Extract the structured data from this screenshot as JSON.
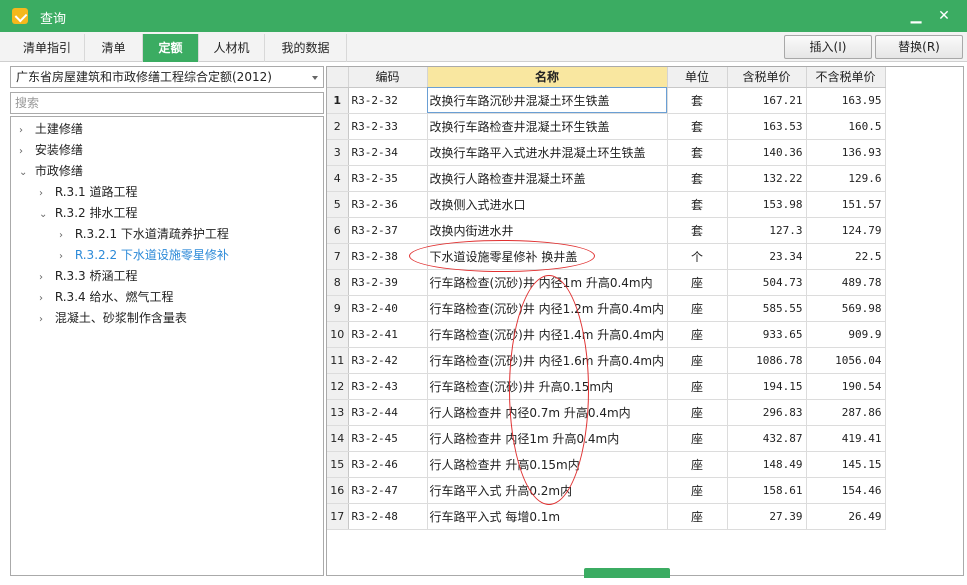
{
  "window": {
    "title": "查询",
    "minimize": "▁",
    "close": "✕"
  },
  "tabs": [
    {
      "label": "清单指引"
    },
    {
      "label": "清单"
    },
    {
      "label": "定额"
    },
    {
      "label": "人材机"
    },
    {
      "label": "我的数据"
    }
  ],
  "actions": {
    "insert": "插入(I)",
    "replace": "替换(R)"
  },
  "library": {
    "selected": "广东省房屋建筑和市政修缮工程综合定额(2012)"
  },
  "search": {
    "placeholder": "搜索"
  },
  "tree": [
    {
      "label": "土建修缮",
      "arrow": "›"
    },
    {
      "label": "安装修缮",
      "arrow": "›"
    },
    {
      "label": "市政修缮",
      "arrow": "⌄"
    },
    {
      "label": "R.3.1 道路工程",
      "arrow": "›"
    },
    {
      "label": "R.3.2 排水工程",
      "arrow": "⌄"
    },
    {
      "label": "R.3.2.1 下水道清疏养护工程",
      "arrow": "›"
    },
    {
      "label": "R.3.2.2 下水道设施零星修补",
      "arrow": "›"
    },
    {
      "label": "R.3.3 桥涵工程",
      "arrow": "›"
    },
    {
      "label": "R.3.4 给水、燃气工程",
      "arrow": "›"
    },
    {
      "label": "混凝土、砂浆制作含量表",
      "arrow": "›"
    }
  ],
  "table": {
    "headers": {
      "code": "编码",
      "name": "名称",
      "unit": "单位",
      "price_tax": "含税单价",
      "price_notax": "不含税单价"
    },
    "rows": [
      {
        "n": "1",
        "code": "R3-2-32",
        "name": "改换行车路沉砂井混凝土环生铁盖",
        "unit": "套",
        "price_tax": "167.21",
        "price_notax": "163.95"
      },
      {
        "n": "2",
        "code": "R3-2-33",
        "name": "改换行车路检查井混凝土环生铁盖",
        "unit": "套",
        "price_tax": "163.53",
        "price_notax": "160.5"
      },
      {
        "n": "3",
        "code": "R3-2-34",
        "name": "改换行车路平入式进水井混凝土环生铁盖",
        "unit": "套",
        "price_tax": "140.36",
        "price_notax": "136.93"
      },
      {
        "n": "4",
        "code": "R3-2-35",
        "name": "改换行人路检查井混凝土环盖",
        "unit": "套",
        "price_tax": "132.22",
        "price_notax": "129.6"
      },
      {
        "n": "5",
        "code": "R3-2-36",
        "name": "改换侧入式进水口",
        "unit": "套",
        "price_tax": "153.98",
        "price_notax": "151.57"
      },
      {
        "n": "6",
        "code": "R3-2-37",
        "name": "改换内街进水井",
        "unit": "套",
        "price_tax": "127.3",
        "price_notax": "124.79"
      },
      {
        "n": "7",
        "code": "R3-2-38",
        "name": "下水道设施零星修补 换井盖",
        "unit": "个",
        "price_tax": "23.34",
        "price_notax": "22.5"
      },
      {
        "n": "8",
        "code": "R3-2-39",
        "name": "行车路检查(沉砂)井 内径1m 升高0.4m内",
        "unit": "座",
        "price_tax": "504.73",
        "price_notax": "489.78"
      },
      {
        "n": "9",
        "code": "R3-2-40",
        "name": "行车路检查(沉砂)井 内径1.2m 升高0.4m内",
        "unit": "座",
        "price_tax": "585.55",
        "price_notax": "569.98"
      },
      {
        "n": "10",
        "code": "R3-2-41",
        "name": "行车路检查(沉砂)井 内径1.4m 升高0.4m内",
        "unit": "座",
        "price_tax": "933.65",
        "price_notax": "909.9"
      },
      {
        "n": "11",
        "code": "R3-2-42",
        "name": "行车路检查(沉砂)井 内径1.6m 升高0.4m内",
        "unit": "座",
        "price_tax": "1086.78",
        "price_notax": "1056.04"
      },
      {
        "n": "12",
        "code": "R3-2-43",
        "name": "行车路检查(沉砂)井 升高0.15m内",
        "unit": "座",
        "price_tax": "194.15",
        "price_notax": "190.54"
      },
      {
        "n": "13",
        "code": "R3-2-44",
        "name": "行人路检查井 内径0.7m 升高0.4m内",
        "unit": "座",
        "price_tax": "296.83",
        "price_notax": "287.86"
      },
      {
        "n": "14",
        "code": "R3-2-45",
        "name": "行人路检查井 内径1m 升高0.4m内",
        "unit": "座",
        "price_tax": "432.87",
        "price_notax": "419.41"
      },
      {
        "n": "15",
        "code": "R3-2-46",
        "name": "行人路检查井 升高0.15m内",
        "unit": "座",
        "price_tax": "148.49",
        "price_notax": "145.15"
      },
      {
        "n": "16",
        "code": "R3-2-47",
        "name": "行车路平入式 升高0.2m内",
        "unit": "座",
        "price_tax": "158.61",
        "price_notax": "154.46"
      },
      {
        "n": "17",
        "code": "R3-2-48",
        "name": "行车路平入式 每增0.1m",
        "unit": "座",
        "price_tax": "27.39",
        "price_notax": "26.49"
      }
    ]
  },
  "colors": {
    "accent": "#3bac62",
    "header_highlight": "#f9e7a0",
    "selected_tree": "#2c8ad8",
    "annotation": "#e03030"
  }
}
